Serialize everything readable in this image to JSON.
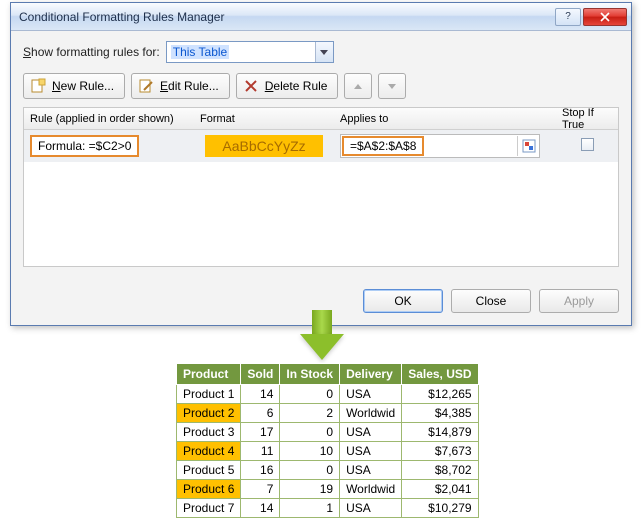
{
  "dialog": {
    "title": "Conditional Formatting Rules Manager",
    "show_label_pre": "S",
    "show_label_post": "how formatting rules for:",
    "scope_value": "This Table",
    "buttons": {
      "new": "New Rule...",
      "edit": "Edit Rule...",
      "delete": "Delete Rule"
    },
    "headers": {
      "rule": "Rule (applied in order shown)",
      "format": "Format",
      "applies": "Applies to",
      "stop": "Stop If True"
    },
    "row": {
      "rule": "Formula: =$C2>0",
      "format_sample": "AaBbCcYyZz",
      "applies": "=$A$2:$A$8"
    },
    "footer": {
      "ok": "OK",
      "close": "Close",
      "apply": "Apply"
    }
  },
  "table": {
    "headers": [
      "Product",
      "Sold",
      "In Stock",
      "Delivery",
      "Sales,  USD"
    ],
    "rows": [
      {
        "p": "Product 1",
        "sold": "14",
        "stock": "0",
        "del": "USA",
        "sales": "$12,265",
        "hl": false
      },
      {
        "p": "Product 2",
        "sold": "6",
        "stock": "2",
        "del": "Worldwid",
        "sales": "$4,385",
        "hl": true
      },
      {
        "p": "Product 3",
        "sold": "17",
        "stock": "0",
        "del": "USA",
        "sales": "$14,879",
        "hl": false
      },
      {
        "p": "Product 4",
        "sold": "11",
        "stock": "10",
        "del": "USA",
        "sales": "$7,673",
        "hl": true
      },
      {
        "p": "Product 5",
        "sold": "16",
        "stock": "0",
        "del": "USA",
        "sales": "$8,702",
        "hl": false
      },
      {
        "p": "Product 6",
        "sold": "7",
        "stock": "19",
        "del": "Worldwid",
        "sales": "$2,041",
        "hl": true
      },
      {
        "p": "Product 7",
        "sold": "14",
        "stock": "1",
        "del": "USA",
        "sales": "$10,279",
        "hl": false
      }
    ]
  }
}
